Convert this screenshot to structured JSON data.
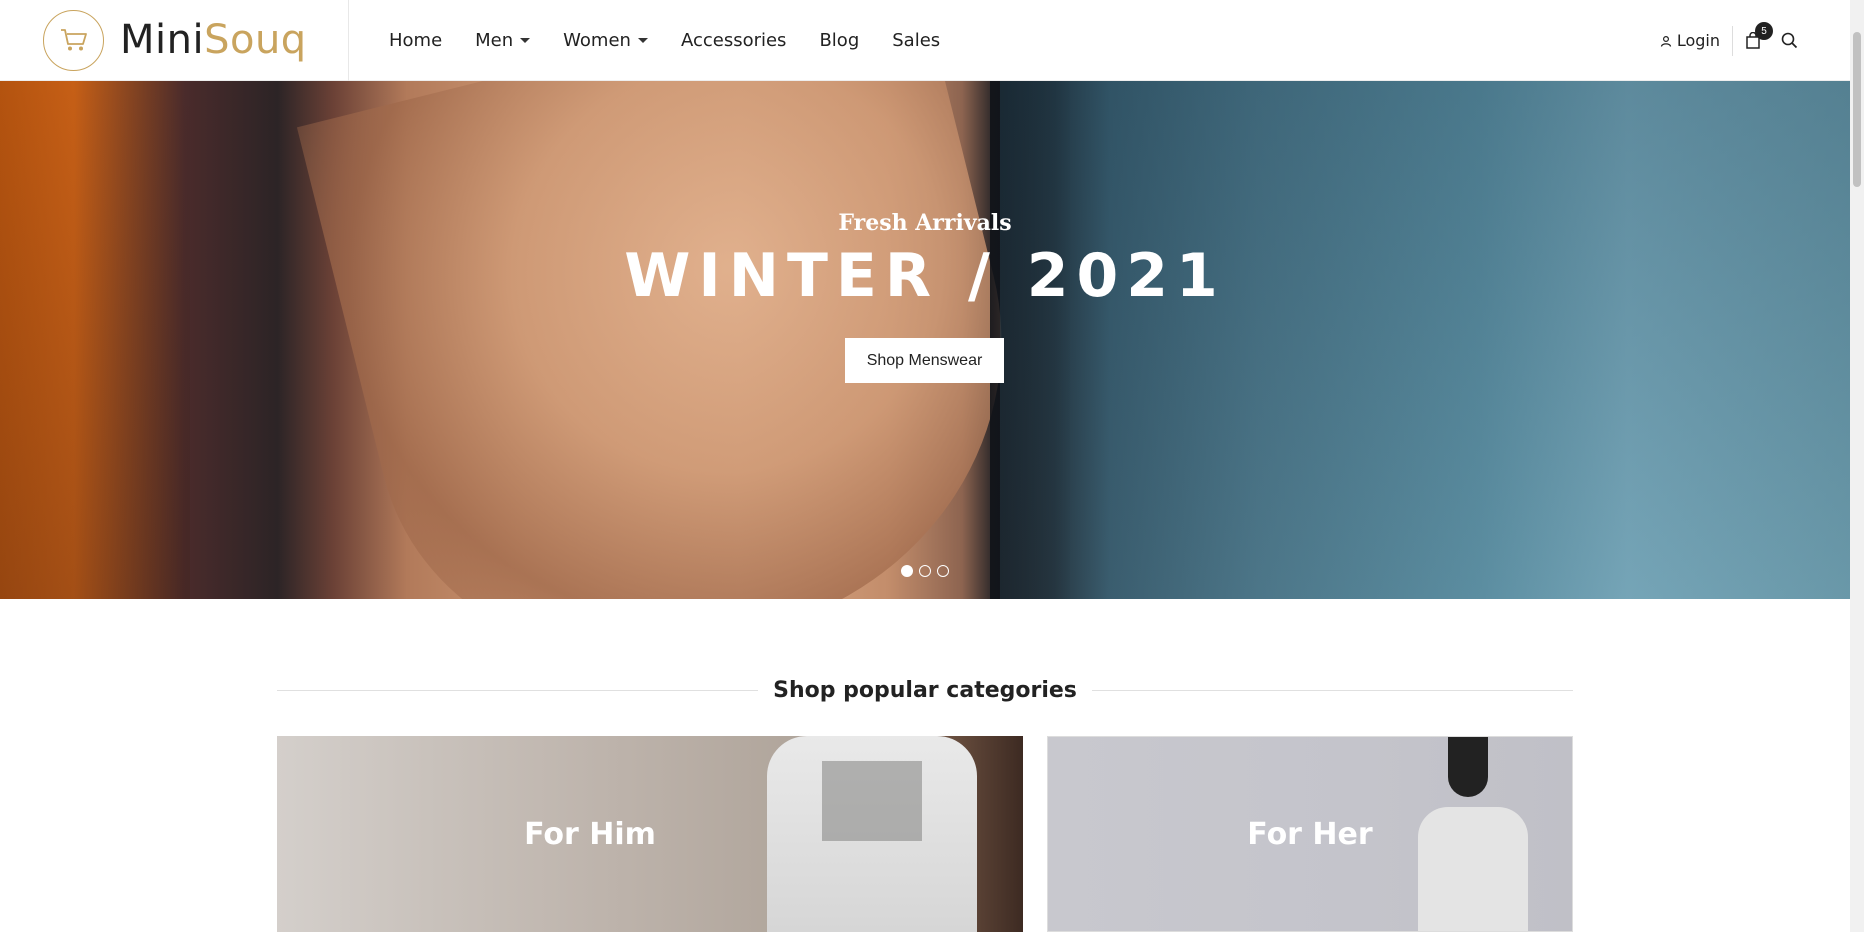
{
  "brand": {
    "name_part1": "Mini",
    "name_part2": "Souq"
  },
  "nav": {
    "items": [
      {
        "label": "Home",
        "dropdown": false
      },
      {
        "label": "Men",
        "dropdown": true
      },
      {
        "label": "Women",
        "dropdown": true
      },
      {
        "label": "Accessories",
        "dropdown": false
      },
      {
        "label": "Blog",
        "dropdown": false
      },
      {
        "label": "Sales",
        "dropdown": false
      }
    ]
  },
  "header_right": {
    "login_label": "Login",
    "cart_count": "5"
  },
  "hero": {
    "subtitle": "Fresh Arrivals",
    "title": "WINTER / 2021",
    "button_label": "Shop Menswear",
    "slides": 3,
    "active_slide": 1
  },
  "categories": {
    "heading": "Shop popular categories",
    "items": [
      {
        "label": "For Him"
      },
      {
        "label": "For Her"
      }
    ]
  },
  "colors": {
    "accent": "#c9a45e",
    "text": "#222222"
  }
}
